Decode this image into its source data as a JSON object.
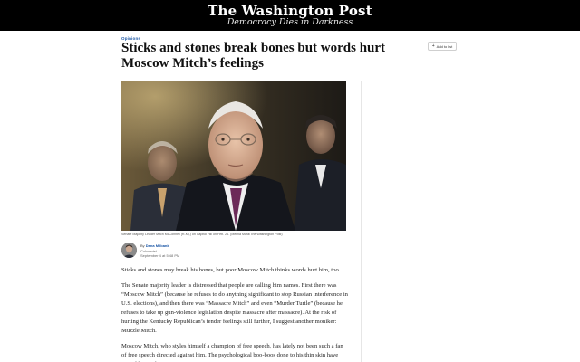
{
  "masthead": {
    "logo": "The Washington Post",
    "tagline": "Democracy Dies in Darkness"
  },
  "article": {
    "kicker": "Opinions",
    "headline": "Sticks and stones break bones but words hurt Moscow Mitch’s feelings",
    "add_to_list_label": "Add to list",
    "photo_caption": "Senate Majority Leader Mitch McConnell (R-Ky.) on Capitol Hill on Feb. 26. (Melina Mara/The Washington Post)",
    "byline": {
      "by": "By",
      "author": "Dana Milbank",
      "role": "Columnist",
      "date": "September 4 at 5:48 PM"
    },
    "paragraphs": [
      "Sticks and stones may break his bones, but poor Moscow Mitch thinks words hurt him, too.",
      "The Senate majority leader is distressed that people are calling him names. First there was “Moscow Mitch” (because he refuses to do anything significant to stop Russian interference in U.S. elections), and then there was “Massacre Mitch” and even “Murder Turtle” (because he refuses to take up gun-violence legislation despite massacre after massacre). At the risk of hurting the Kentucky Republican’s tender feelings still further, I suggest another moniker: Muzzle Mitch.",
      "Moscow Mitch, who styles himself a champion of free speech, has lately not been such a fan of free speech directed against him. The psychological boo-boos done to his thin skin have stirred him to hypocrisy."
    ]
  },
  "colors": {
    "masthead_bg": "#000000",
    "link_blue": "#1955a5",
    "headline": "#111111"
  },
  "icons": {
    "add_list": "plus-icon"
  }
}
